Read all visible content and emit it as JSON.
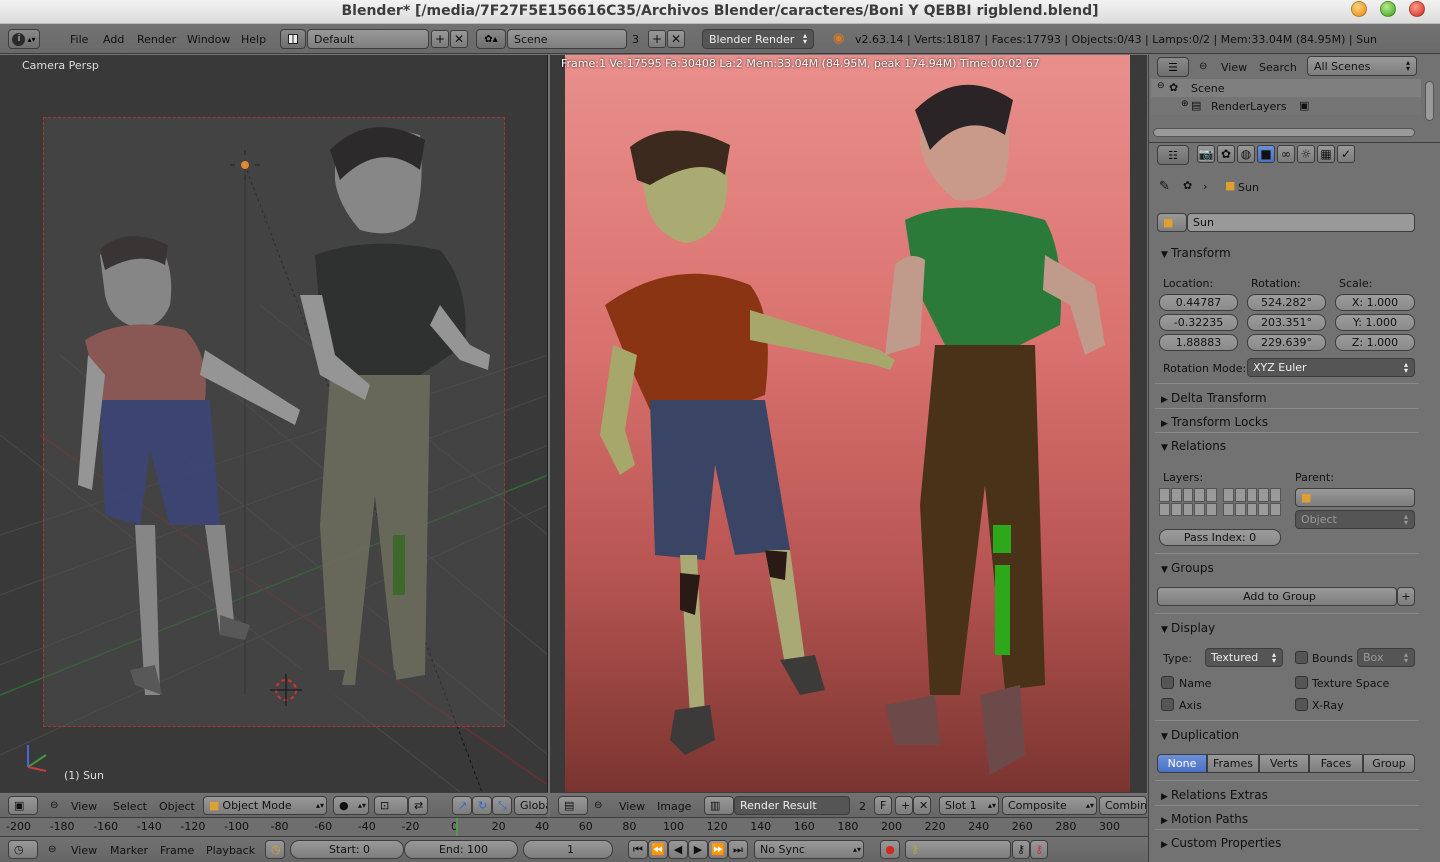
{
  "window": {
    "title": "Blender* [/media/7F27F5E156616C35/Archivos  Blender/caracteres/Boni Y QEBBI rigblend.blend]"
  },
  "info_header": {
    "menus": [
      "File",
      "Add",
      "Render",
      "Window",
      "Help"
    ],
    "layout": "Default",
    "scene": "Scene",
    "scene_users": "3",
    "engine": "Blender Render",
    "stats": "v2.63.14 | Verts:18187 | Faces:17793 | Objects:0/43 | Lamps:0/2 | Mem:33.04M (84.95M) | Sun"
  },
  "viewport3d": {
    "label": "Camera Persp",
    "object_label": "(1) Sun",
    "menus": [
      "View",
      "Select",
      "Object"
    ],
    "mode": "Object Mode",
    "orientation": "Global"
  },
  "render_view": {
    "stats": "Frame:1 Ve:17595 Fa:30408 La:2 Mem:33.04M (84.95M, peak 174.94M) Time:00:02.67",
    "menus": [
      "View",
      "Image"
    ],
    "image_name": "Render Result",
    "image_users": "2",
    "fake_user": "F",
    "slot": "Slot 1",
    "pass": "Composite",
    "layer": "Combine"
  },
  "timeline": {
    "ticks": [
      "-200",
      "-180",
      "-160",
      "-140",
      "-120",
      "-100",
      "-80",
      "-60",
      "-40",
      "-20",
      "0",
      "20",
      "40",
      "60",
      "80",
      "100",
      "120",
      "140",
      "160",
      "180",
      "200",
      "220",
      "240",
      "260",
      "280",
      "300"
    ],
    "menus": [
      "View",
      "Marker",
      "Frame",
      "Playback"
    ],
    "start": "Start: 0",
    "end": "End: 100",
    "current": "1",
    "sync": "No Sync"
  },
  "outliner": {
    "menus": [
      "View",
      "Search"
    ],
    "filter": "All Scenes",
    "items": [
      "Scene",
      "RenderLayers"
    ]
  },
  "properties": {
    "context_object": "Sun",
    "object_name": "Sun",
    "panels": {
      "transform": "Transform",
      "location_label": "Location:",
      "rotation_label": "Rotation:",
      "scale_label": "Scale:",
      "location": [
        "0.44787",
        "-0.32235",
        "1.88883"
      ],
      "rotation": [
        "524.282°",
        "203.351°",
        "229.639°"
      ],
      "scale": [
        "X: 1.000",
        "Y: 1.000",
        "Z: 1.000"
      ],
      "rotation_mode_label": "Rotation Mode:",
      "rotation_mode": "XYZ Euler",
      "delta_transform": "Delta Transform",
      "transform_locks": "Transform Locks",
      "relations": "Relations",
      "layers_label": "Layers:",
      "parent_label": "Parent:",
      "parent_type": "Object",
      "pass_index": "Pass Index: 0",
      "groups": "Groups",
      "add_to_group": "Add to Group",
      "display": "Display",
      "type_label": "Type:",
      "display_type": "Textured",
      "bounds": "Bounds",
      "bounds_type": "Box",
      "name": "Name",
      "texture_space": "Texture Space",
      "axis": "Axis",
      "xray": "X-Ray",
      "duplication": "Duplication",
      "dup_options": [
        "None",
        "Frames",
        "Verts",
        "Faces",
        "Group"
      ],
      "relations_extras": "Relations Extras",
      "motion_paths": "Motion Paths",
      "custom_properties": "Custom Properties"
    }
  },
  "colors": {
    "ui_gray": "#727272",
    "viewport_bg": "#393939",
    "render_top": "#e98f8b",
    "render_bottom": "#7a3430",
    "active_button": "#4a72c4"
  }
}
